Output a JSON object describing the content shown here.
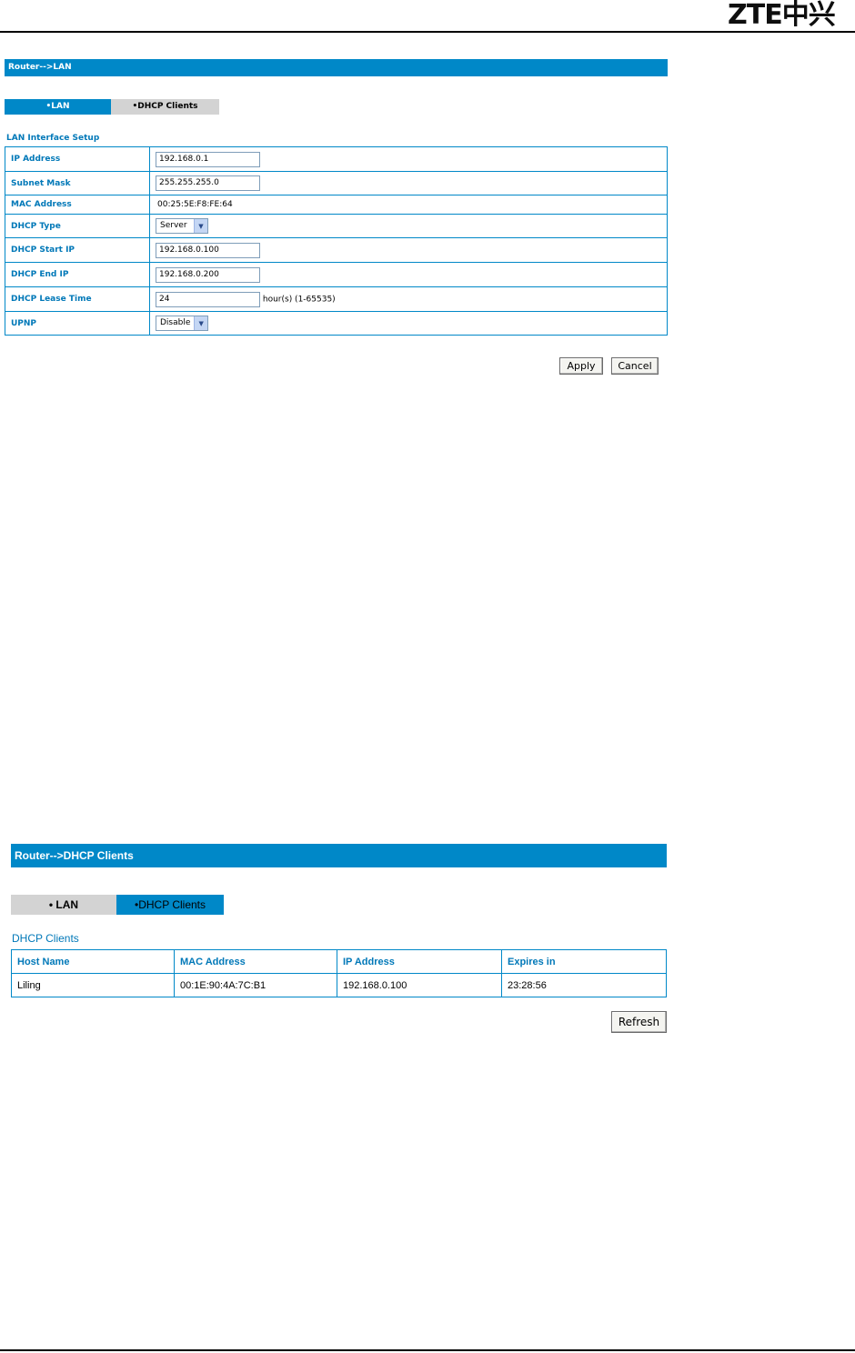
{
  "page": {
    "logo_text": "ZTE中兴"
  },
  "lan_screen": {
    "title": "Router-->LAN",
    "tabs": [
      "•LAN",
      "•DHCP Clients"
    ],
    "active_tab": 0,
    "section_title": "LAN Interface Setup",
    "fields": {
      "ip_address": {
        "label": "IP Address",
        "value": "192.168.0.1"
      },
      "subnet_mask": {
        "label": "Subnet Mask",
        "value": "255.255.255.0"
      },
      "mac_address": {
        "label": "MAC Address",
        "value": "00:25:5E:F8:FE:64"
      },
      "dhcp_type": {
        "label": "DHCP Type",
        "value": "Server"
      },
      "dhcp_start_ip": {
        "label": "DHCP Start IP",
        "value": "192.168.0.100"
      },
      "dhcp_end_ip": {
        "label": "DHCP End IP",
        "value": "192.168.0.200"
      },
      "dhcp_lease_time": {
        "label": "DHCP Lease Time",
        "value": "24",
        "suffix": "hour(s) (1-65535)"
      },
      "upnp": {
        "label": "UPNP",
        "value": "Disable"
      }
    },
    "apply_label": "Apply",
    "cancel_label": "Cancel"
  },
  "dhcp_screen": {
    "title": "Router-->DHCP Clients",
    "tabs": [
      "• LAN",
      "•DHCP Clients"
    ],
    "active_tab": 1,
    "section_title": "DHCP Clients",
    "columns": [
      "Host Name",
      "MAC Address",
      "IP Address",
      "Expires in"
    ],
    "rows": [
      [
        "Liling",
        "00:1E:90:4A:7C:B1",
        "192.168.0.100",
        "23:28:56"
      ]
    ],
    "refresh_label": "Refresh"
  },
  "colors": {
    "accent": "#0088c8",
    "label_text": "#0078b8",
    "inactive_tab": "#d3d3d3"
  }
}
